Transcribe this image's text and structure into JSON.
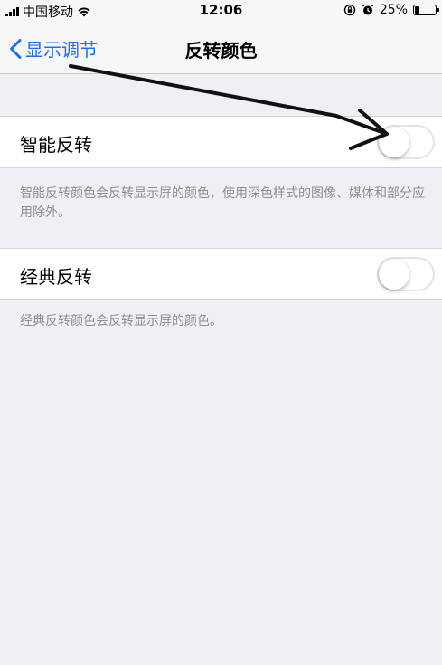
{
  "status_bar": {
    "carrier": "中国移动",
    "time": "12:06",
    "battery": "25%",
    "battery_level": 0.25
  },
  "nav": {
    "back_label": "显示调节",
    "title": "反转颜色"
  },
  "settings": [
    {
      "label": "智能反转",
      "enabled": false,
      "footer": "智能反转颜色会反转显示屏的颜色，使用深色样式的图像、媒体和部分应用除外。"
    },
    {
      "label": "经典反转",
      "enabled": false,
      "footer": "经典反转颜色会反转显示屏的颜色。"
    }
  ],
  "colors": {
    "accent": "#1f6fea",
    "background": "#efeff4",
    "footer_text": "#8e8e93"
  },
  "icons": {
    "signal": "cellular-signal-icon",
    "wifi": "wifi-icon",
    "location": "orientation-lock-icon",
    "alarm": "alarm-icon",
    "battery": "battery-icon",
    "back": "chevron-left-icon",
    "annotation": "hand-drawn-arrow-icon"
  }
}
